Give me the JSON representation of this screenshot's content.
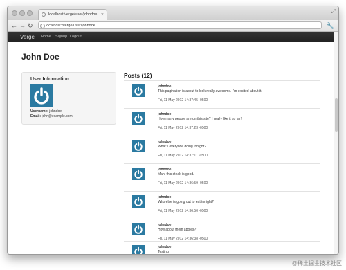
{
  "browser": {
    "tab_title": "localhost/verge/user/johndoe",
    "address": "localhost:/verge/user/johndoe",
    "nav_icons": [
      "back-icon",
      "forward-icon",
      "reload-icon"
    ],
    "menu_icon": "wrench-icon"
  },
  "app": {
    "brand": "Verge",
    "nav_links": [
      "Home",
      "Signup",
      "Logout"
    ]
  },
  "profile": {
    "name": "John Doe",
    "box_title": "User Information",
    "username_label": "Username:",
    "username": "johndoe",
    "email_label": "Email:",
    "email": "john@example.com"
  },
  "posts": {
    "heading": "Posts (12)",
    "items": [
      {
        "author": "johndoe",
        "text": "This pagination is about to look really awesome. I'm excited about it.",
        "time": "Fri, 11 May 2012 14:37:45 -0500"
      },
      {
        "author": "johndoe",
        "text": "How many people are on this site? I really like it so far!",
        "time": "Fri, 11 May 2012 14:37:23 -0500"
      },
      {
        "author": "johndoe",
        "text": "What's everyone doing tonight?",
        "time": "Fri, 11 May 2012 14:37:11 -0500"
      },
      {
        "author": "johndoe",
        "text": "Man, this steak is good.",
        "time": "Fri, 11 May 2012 14:36:59 -0500"
      },
      {
        "author": "johndoe",
        "text": "Who else is going out to eat tonight?",
        "time": "Fri, 11 May 2012 14:36:50 -0500"
      },
      {
        "author": "johndoe",
        "text": "How about them apples?",
        "time": "Fri, 11 May 2012 14:36:38 -0500"
      },
      {
        "author": "johndoe",
        "text": "Testing",
        "time": ""
      }
    ]
  },
  "watermark": "@稀土掘金技术社区",
  "colors": {
    "navbar": "#222222",
    "avatar": "#2b7aa1",
    "box_bg": "#f5f5f5"
  }
}
